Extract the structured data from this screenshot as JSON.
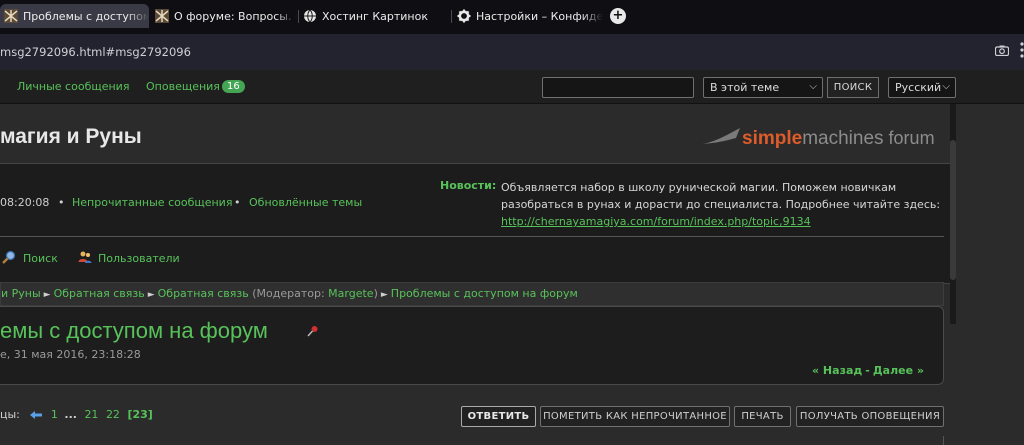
{
  "browser": {
    "tabs": [
      {
        "title": "Проблемы с доступом на",
        "active": true,
        "icon": "forum-favicon"
      },
      {
        "title": "О форуме: Вопросы. Отв",
        "active": false,
        "icon": "forum-favicon"
      },
      {
        "title": "Хостинг Картинок",
        "active": false,
        "icon": "globe-icon"
      },
      {
        "title": "Настройки – Конфиденц",
        "active": false,
        "icon": "gear-icon"
      }
    ],
    "new_tab": "+",
    "url": "msg2792096.html#msg2792096"
  },
  "topmenu": {
    "private_messages": "Личные сообщения",
    "notifications": "Оповещения",
    "notifications_count": "16",
    "search_scope": "В этой теме",
    "search_button": "ПОИСК",
    "language": "Русский"
  },
  "header": {
    "forum_title": "магия и Руны",
    "logo": {
      "part1": "simple",
      "part2": "machines",
      "part3": "forum"
    }
  },
  "info": {
    "time": "08:20:08",
    "unread": "Непрочитанные сообщения",
    "updated": "Обновлённые темы",
    "news_label": "Новости:",
    "news_text": "Объявляется набор в школу рунической магии. Поможем новичкам разобраться в рунах и дорасти до специалиста. Подробнее читайте здесь:",
    "news_link": "http://chernayamagiya.com/forum/index.php/topic,9134",
    "search_link": "Поиск",
    "users_link": "Пользователи"
  },
  "breadcrumb": {
    "items": [
      "и Руны",
      "Обратная связь",
      "Обратная связь"
    ],
    "moderator_prefix": "(Модератор:",
    "moderator": "Margete",
    "moderator_suffix": ")",
    "current": "Проблемы с доступом на форум"
  },
  "topic": {
    "title": "емы с доступом на форум",
    "date": "е, 31 мая 2016, 23:18:28",
    "prev": "« Назад",
    "next": "Далее »"
  },
  "pages": {
    "label": "цы:",
    "items": [
      "1",
      "...",
      "21",
      "22"
    ],
    "current": "[23]"
  },
  "buttons": {
    "reply": "ОТВЕТИТЬ",
    "mark_unread": "ПОМЕТИТЬ КАК НЕПРОЧИТАННОЕ",
    "print": "ПЕЧАТЬ",
    "notify": "ПОЛУЧАТЬ ОПОВЕЩЕНИЯ"
  },
  "colors": {
    "accent_green": "#58c25a",
    "logo_orange": "#dd5c2a",
    "background": "#2b2b2b"
  }
}
